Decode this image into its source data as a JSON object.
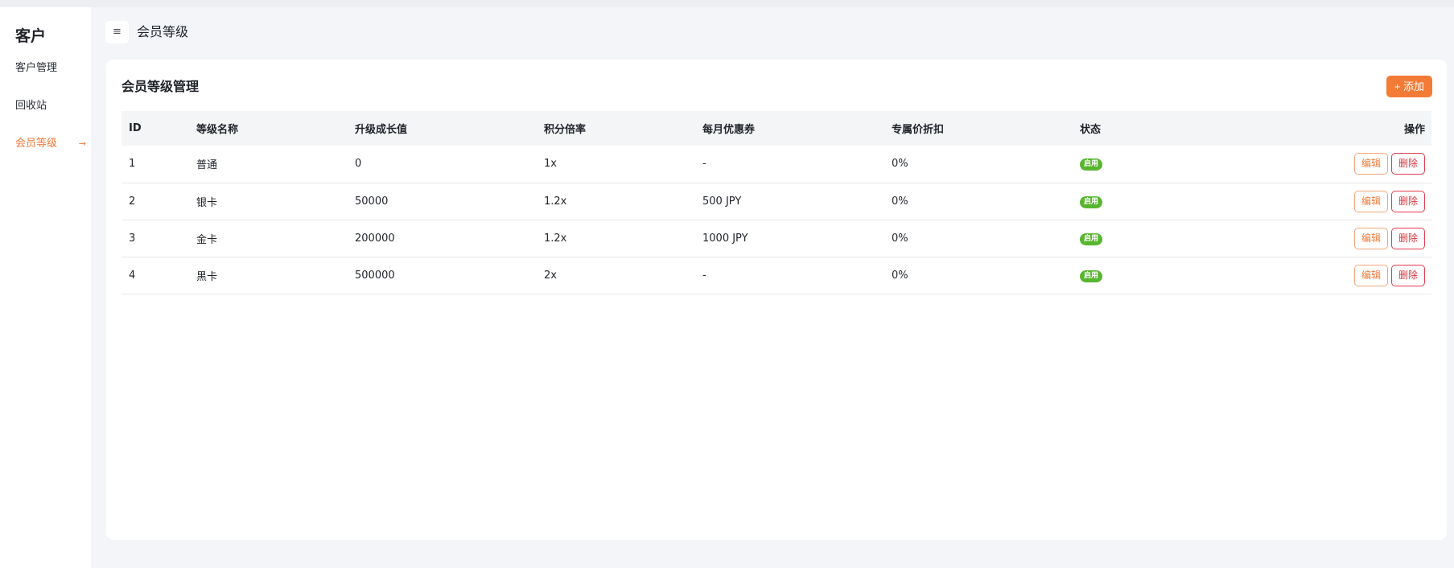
{
  "sidebar": {
    "title": "客户",
    "items": [
      {
        "label": "客户管理"
      },
      {
        "label": "回收站"
      },
      {
        "label": "会员等级",
        "arrow": "→"
      }
    ]
  },
  "header": {
    "menu_icon": "≡",
    "title": "会员等级"
  },
  "card": {
    "title": "会员等级管理",
    "add_label": "+ 添加"
  },
  "table": {
    "columns": [
      "ID",
      "等级名称",
      "升级成长值",
      "积分倍率",
      "每月优惠券",
      "专属价折扣",
      "状态",
      "操作"
    ],
    "rows": [
      {
        "id": "1",
        "name": "普通",
        "growth": "0",
        "multiplier": "1x",
        "coupon": "-",
        "discount": "0%",
        "status": "启用"
      },
      {
        "id": "2",
        "name": "银卡",
        "growth": "50000",
        "multiplier": "1.2x",
        "coupon": "500 JPY",
        "discount": "0%",
        "status": "启用"
      },
      {
        "id": "3",
        "name": "金卡",
        "growth": "200000",
        "multiplier": "1.2x",
        "coupon": "1000 JPY",
        "discount": "0%",
        "status": "启用"
      },
      {
        "id": "4",
        "name": "黑卡",
        "growth": "500000",
        "multiplier": "2x",
        "coupon": "-",
        "discount": "0%",
        "status": "启用"
      }
    ],
    "edit_label": "编辑",
    "delete_label": "删除"
  },
  "colors": {
    "accent": "#f47b35",
    "status_enabled": "#58b52f",
    "danger": "#d9363e"
  }
}
